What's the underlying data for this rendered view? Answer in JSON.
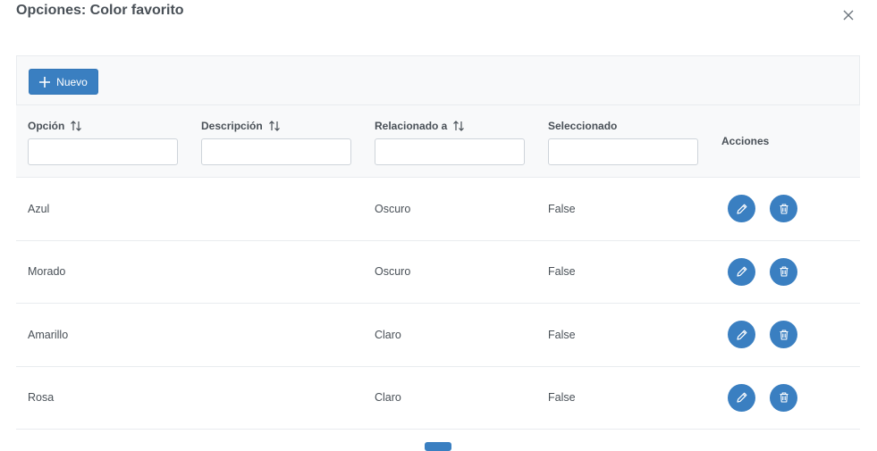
{
  "dialog": {
    "title": "Opciones: Color favorito",
    "close_icon": "close-icon"
  },
  "toolbar": {
    "new_label": "Nuevo",
    "new_icon": "plus-icon"
  },
  "table": {
    "columns": [
      {
        "label": "Opción",
        "sortable": true,
        "filter_value": ""
      },
      {
        "label": "Descripción",
        "sortable": true,
        "filter_value": ""
      },
      {
        "label": "Relacionado a",
        "sortable": true,
        "filter_value": ""
      },
      {
        "label": "Seleccionado",
        "sortable": false,
        "filter_value": ""
      },
      {
        "label": "Acciones",
        "sortable": false
      }
    ],
    "rows": [
      {
        "opcion": "Azul",
        "descripcion": "",
        "relacionado": "Oscuro",
        "seleccionado": "False"
      },
      {
        "opcion": "Morado",
        "descripcion": "",
        "relacionado": "Oscuro",
        "seleccionado": "False"
      },
      {
        "opcion": "Amarillo",
        "descripcion": "",
        "relacionado": "Claro",
        "seleccionado": "False"
      },
      {
        "opcion": "Rosa",
        "descripcion": "",
        "relacionado": "Claro",
        "seleccionado": "False"
      }
    ],
    "row_actions": [
      "pencil-icon",
      "trash-icon"
    ]
  },
  "colors": {
    "primary": "#3a7fc1",
    "header_bg": "#f8f9fa",
    "text": "#495057",
    "border": "#e9ecef"
  }
}
